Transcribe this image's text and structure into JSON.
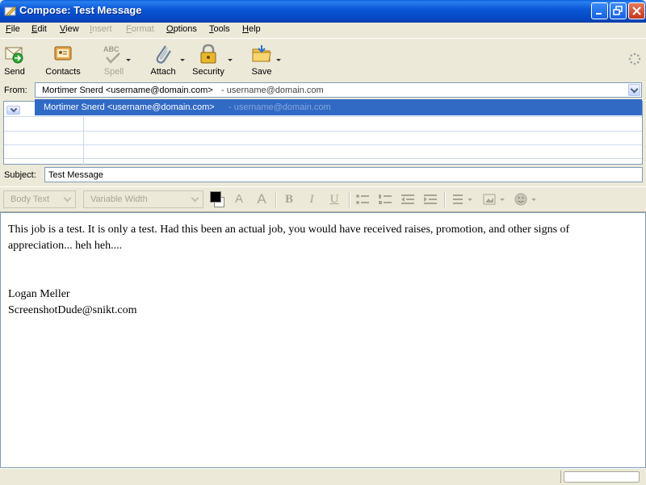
{
  "window": {
    "title": "Compose: Test Message",
    "controls": [
      "minimize",
      "maximize",
      "close"
    ]
  },
  "menu": [
    {
      "label": "File",
      "enabled": true
    },
    {
      "label": "Edit",
      "enabled": true
    },
    {
      "label": "View",
      "enabled": true
    },
    {
      "label": "Insert",
      "enabled": false
    },
    {
      "label": "Format",
      "enabled": false
    },
    {
      "label": "Options",
      "enabled": true
    },
    {
      "label": "Tools",
      "enabled": true
    },
    {
      "label": "Help",
      "enabled": true
    }
  ],
  "toolbar": {
    "send": {
      "label": "Send",
      "icon": "send-icon"
    },
    "contacts": {
      "label": "Contacts",
      "icon": "contacts-icon"
    },
    "spell": {
      "label": "Spell",
      "icon": "spellcheck-icon",
      "enabled": false
    },
    "attach": {
      "label": "Attach",
      "icon": "paperclip-icon"
    },
    "security": {
      "label": "Security",
      "icon": "lock-icon"
    },
    "save": {
      "label": "Save",
      "icon": "folder-icon"
    }
  },
  "from": {
    "label": "From:",
    "name": "Mortimer Snerd <username@domain.com>",
    "account": "- username@domain.com"
  },
  "dropdown": {
    "name": "Mortimer Snerd <username@domain.com>",
    "account": "- username@domain.com"
  },
  "subject": {
    "label": "Subject:",
    "value": "Test Message"
  },
  "format": {
    "paragraph_style": "Body Text",
    "font": "Variable Width"
  },
  "body": {
    "lines": [
      "This job is a test.  It is only a test.  Had this been an actual job, you would have received raises, promotion, and other signs of",
      "appreciation... heh heh....",
      "",
      "",
      "Logan Meller",
      "ScreenshotDude@snikt.com"
    ]
  },
  "colors": {
    "titlebar": "#0b58d6",
    "selection": "#316ac5",
    "chrome": "#ece9d8"
  }
}
